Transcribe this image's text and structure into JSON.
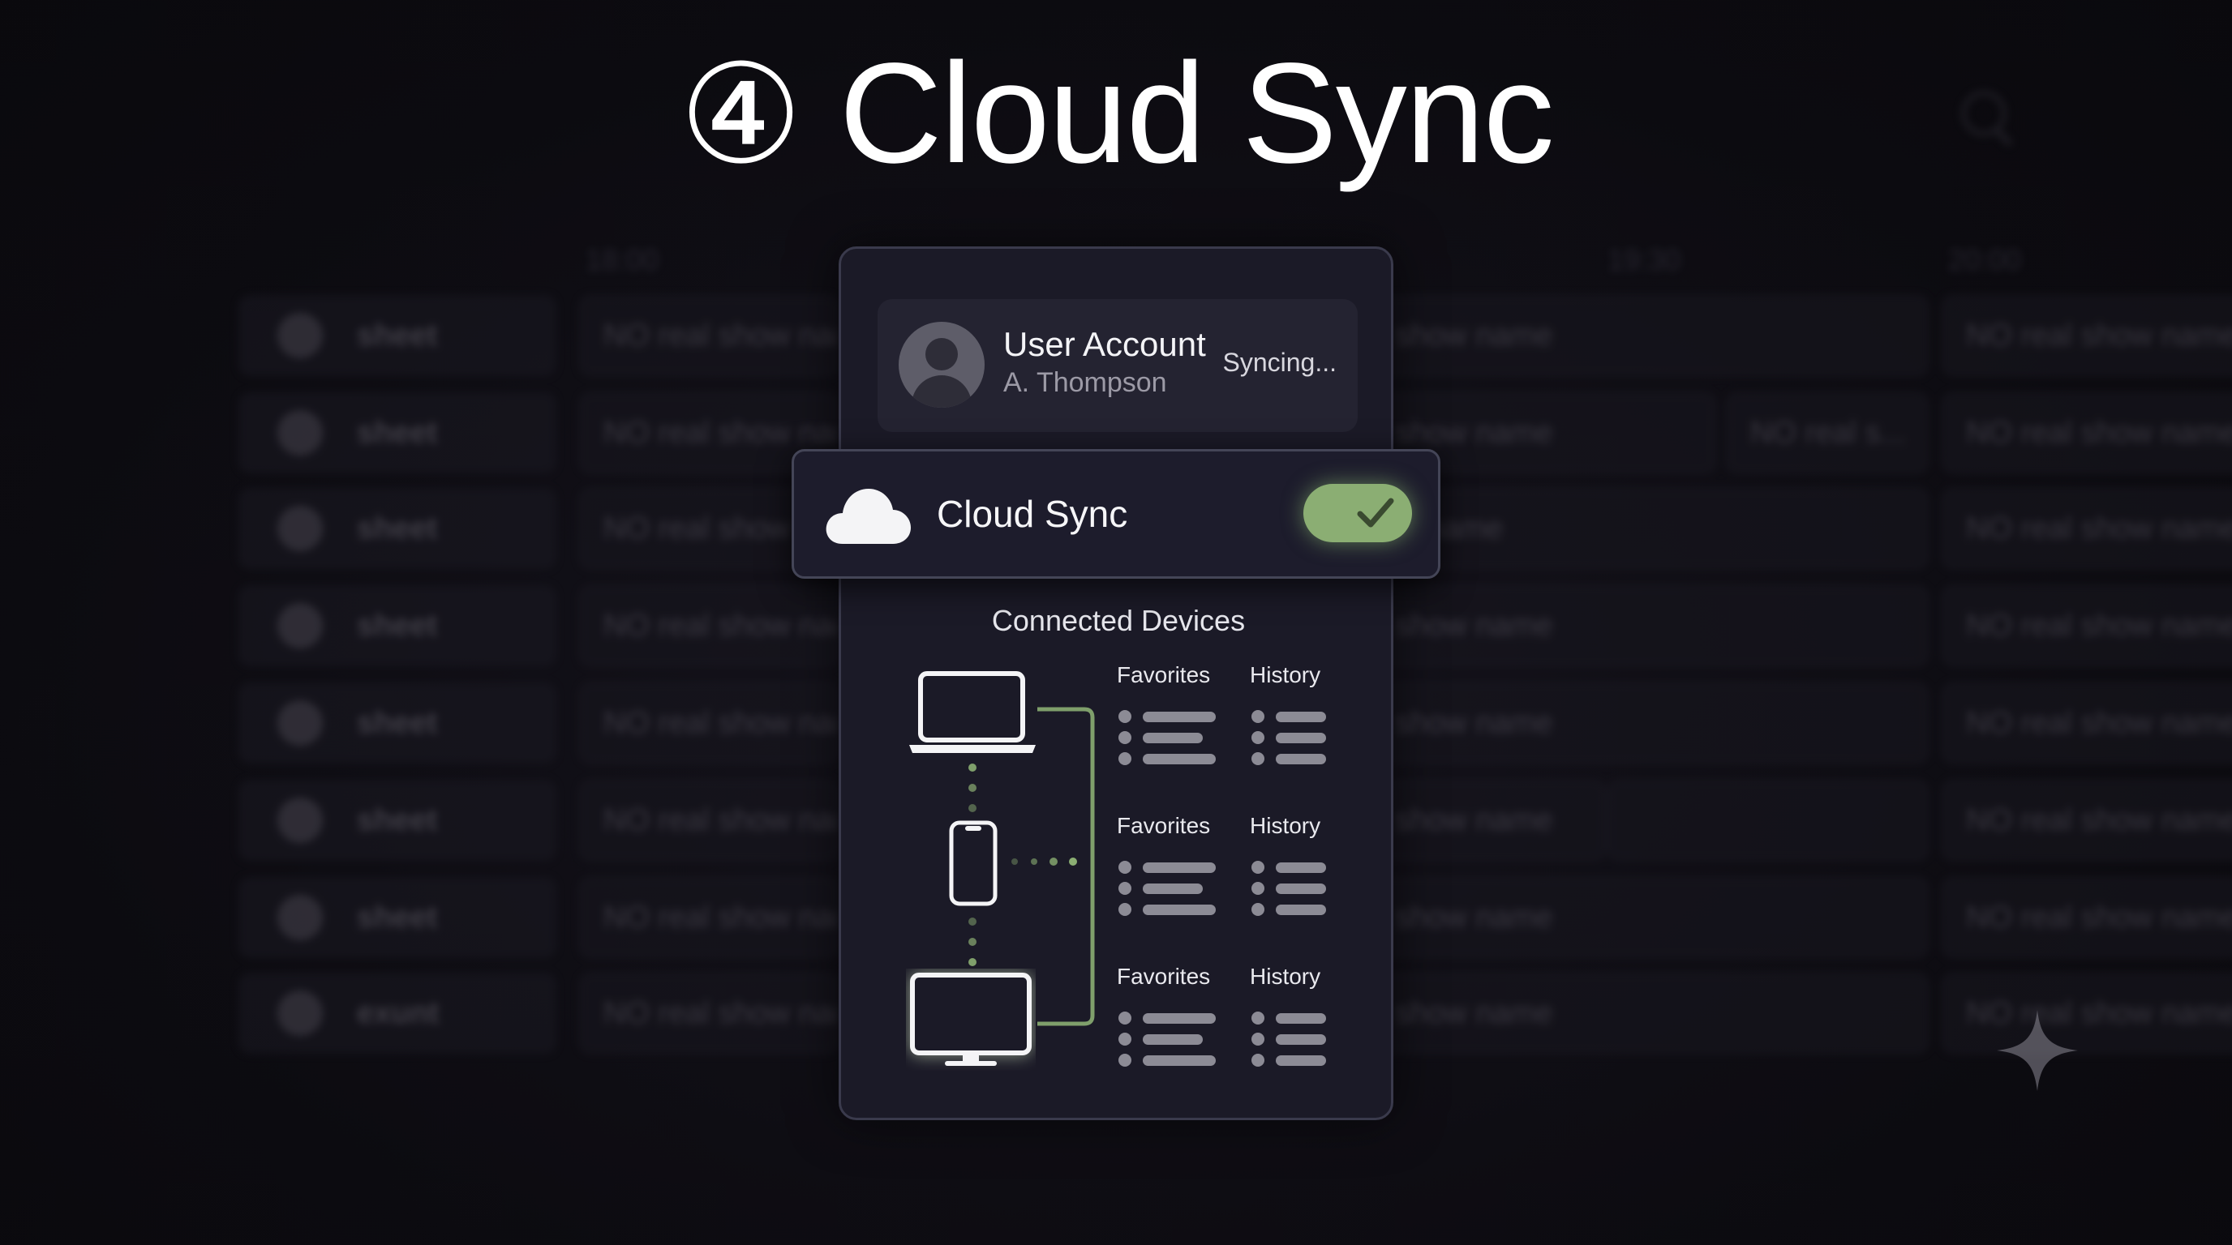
{
  "header": {
    "step_number": "④",
    "title": "Cloud Sync"
  },
  "guide_background": {
    "time_labels": [
      "18:00",
      "19:30",
      "20:00"
    ],
    "channels": [
      "sheet",
      "sheet",
      "sheet",
      "sheet",
      "sheet",
      "sheet",
      "sheet",
      "exunt"
    ],
    "program_left": [
      "NO real show nan",
      "NO real show nan",
      "NO real show",
      "NO real show nan",
      "NO real show nan",
      "NO real show nan",
      "NO real show nan",
      "NO real show nan"
    ],
    "program_mid": [
      "show name",
      "show name",
      "w name",
      "show name",
      "show name",
      "show name",
      "show name",
      "show name"
    ],
    "program_mid2": "NO real s...",
    "program_right": [
      "NO real show name",
      "NO real show name",
      "NO real show name",
      "NO real show name",
      "NO real show name",
      "NO real show name",
      "NO real show name",
      "NO real show name"
    ]
  },
  "account": {
    "title": "User Account",
    "name": "A. Thompson",
    "status": "Syncing..."
  },
  "sync": {
    "label": "Cloud Sync",
    "enabled": true,
    "toggle_color": "#8bae73"
  },
  "devices": {
    "title": "Connected Devices",
    "items": [
      {
        "icon": "laptop-icon",
        "favorites": "Favorites",
        "history": "History"
      },
      {
        "icon": "phone-icon",
        "favorites": "Favorites",
        "history": "History"
      },
      {
        "icon": "tv-monitor-icon",
        "favorites": "Favorites",
        "history": "History"
      }
    ],
    "connector_color": "#8bae73"
  }
}
